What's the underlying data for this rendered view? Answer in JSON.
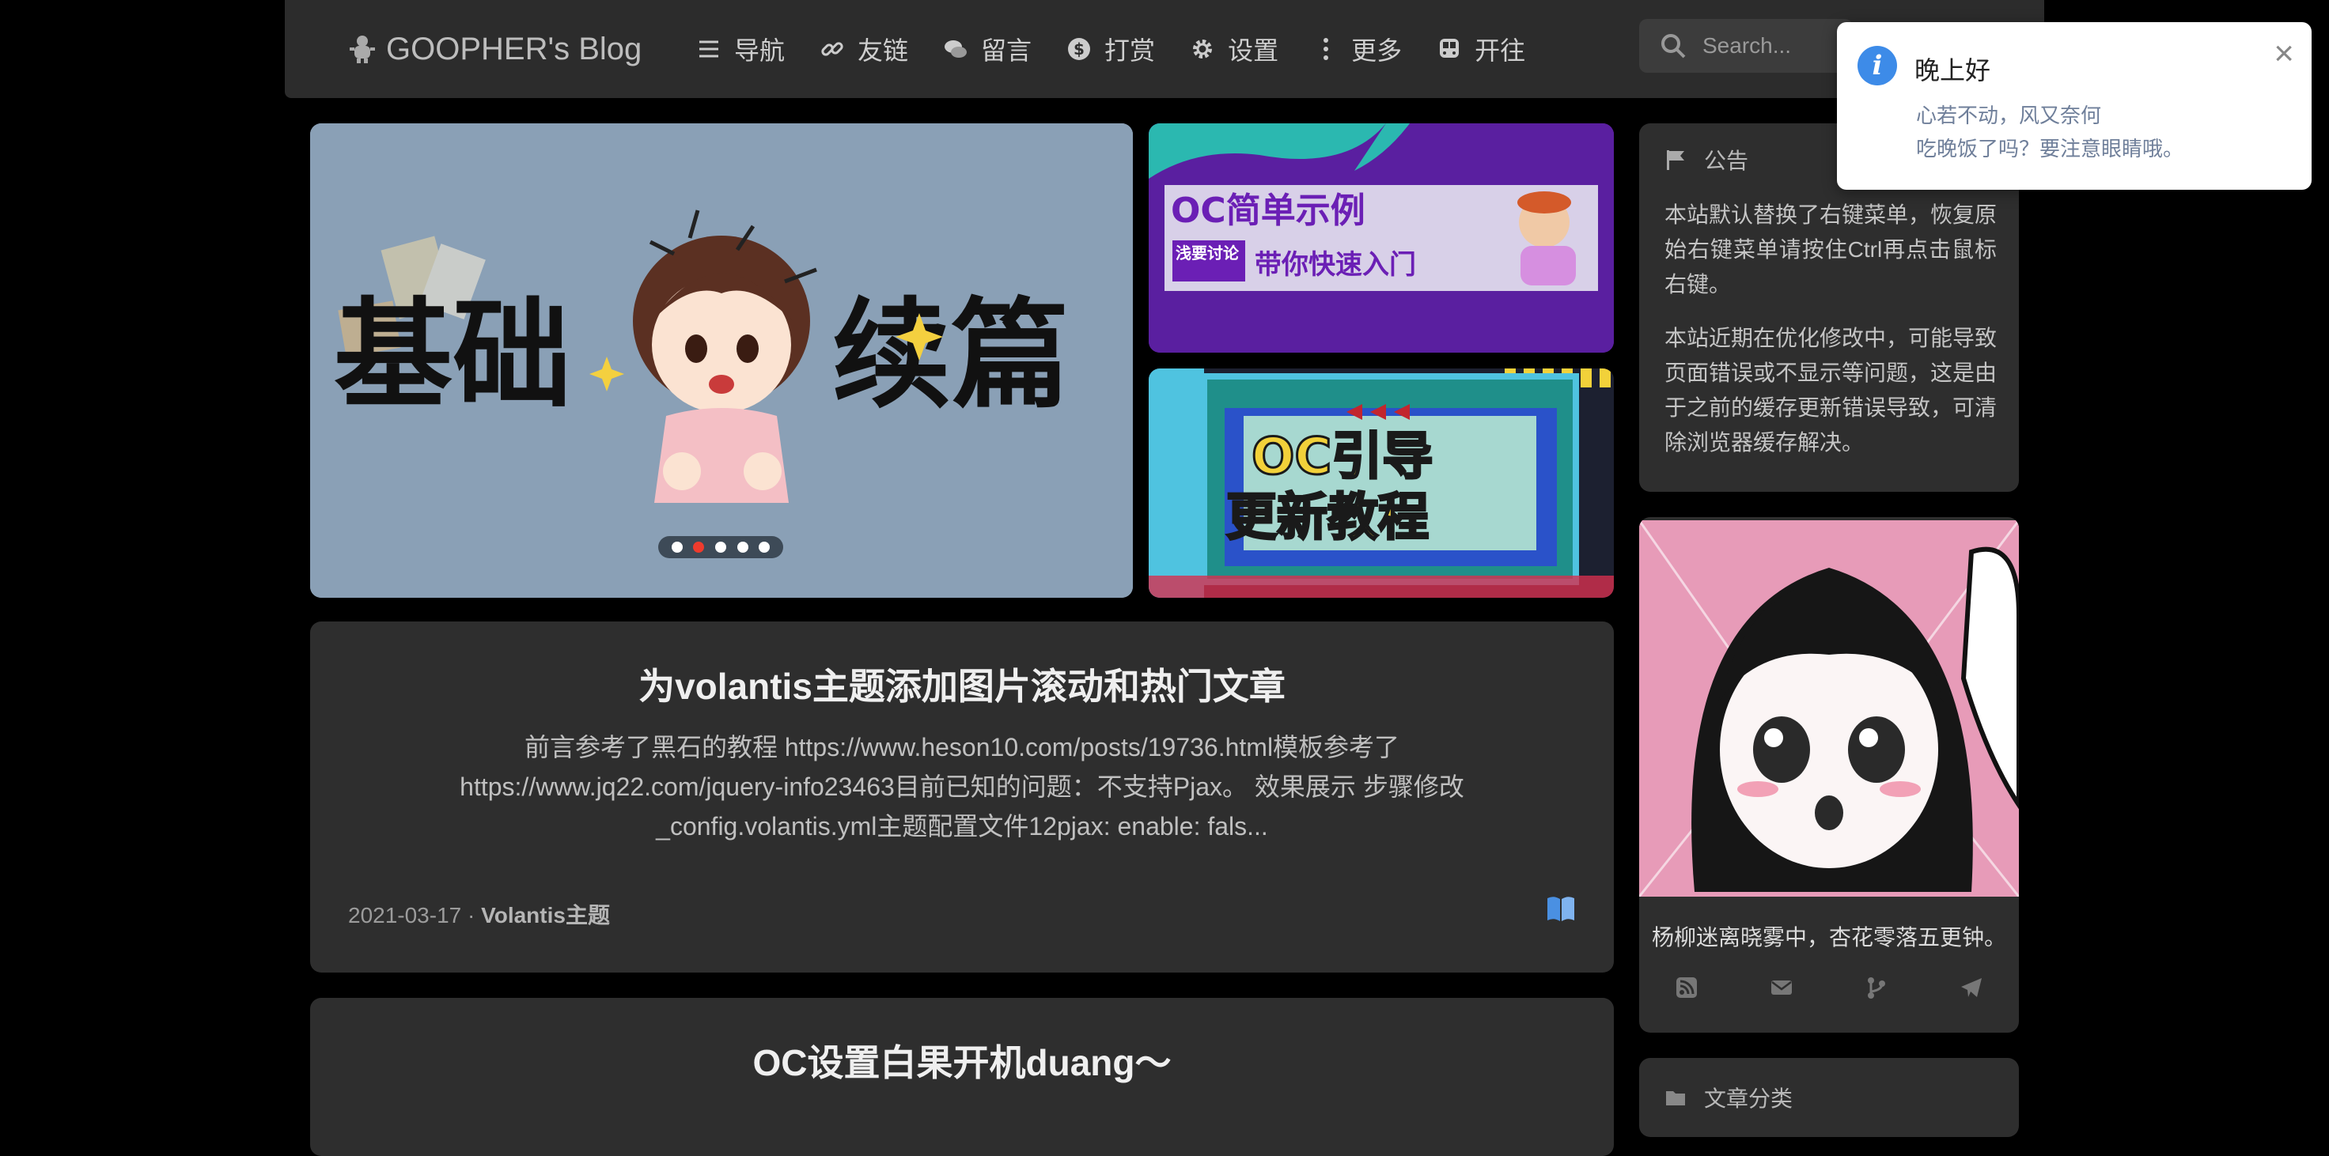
{
  "header": {
    "brand": "GOOPHER's Blog",
    "nav": [
      {
        "label": "导航",
        "icon": "list-icon"
      },
      {
        "label": "友链",
        "icon": "link-icon"
      },
      {
        "label": "留言",
        "icon": "comments-icon"
      },
      {
        "label": "打赏",
        "icon": "dollar-icon"
      },
      {
        "label": "设置",
        "icon": "gear-icon"
      },
      {
        "label": "更多",
        "icon": "ellipsis-vertical-icon"
      },
      {
        "label": "开往",
        "icon": "train-icon"
      }
    ],
    "search_placeholder": "Search..."
  },
  "slider": {
    "image_text": [
      "基础",
      "续篇"
    ],
    "dots": 5,
    "active_dot": 2
  },
  "thumbs": [
    {
      "line1": "OC简单示例",
      "line2a": "浅要讨论",
      "line2b": "带你快速入门"
    },
    {
      "line1": "OC引导",
      "line2": "更新教程"
    }
  ],
  "posts": [
    {
      "title": "为volantis主题添加图片滚动和热门文章",
      "excerpt": "前言参考了黑石的教程 https://www.heson10.com/posts/19736.html模板参考了https://www.jq22.com/jquery-info23463目前已知的问题：不支持Pjax。 效果展示 步骤修改_config.volantis.yml主题配置文件12pjax: enable: fals...",
      "date": "2021-03-17",
      "category": "Volantis主题"
    },
    {
      "title": "OC设置白果开机duang～"
    }
  ],
  "sidebar": {
    "announcement": {
      "title": "公告",
      "paragraphs": [
        "本站默认替换了右键菜单，恢复原始右键菜单请按住Ctrl再点击鼠标右键。",
        "本站近期在优化修改中，可能导致页面错误或不显示等问题，这是由于之前的缓存更新错误导致，可清除浏览器缓存解决。"
      ]
    },
    "profile": {
      "quote": "杨柳迷离晓雾中，杏花零落五更钟。",
      "links": [
        "rss-icon",
        "email-icon",
        "git-branch-icon",
        "telegram-icon"
      ]
    },
    "categories_title": "文章分类"
  },
  "toast": {
    "title": "晚上好",
    "line1": "心若不动，风又奈何",
    "line2": "吃晚饭了吗？要注意眼睛哦。"
  },
  "colors": {
    "accent": "#3d8be8",
    "active_dot": "#ee3b2d",
    "card": "#2e2e2e",
    "navbar": "#2c2c2c"
  }
}
